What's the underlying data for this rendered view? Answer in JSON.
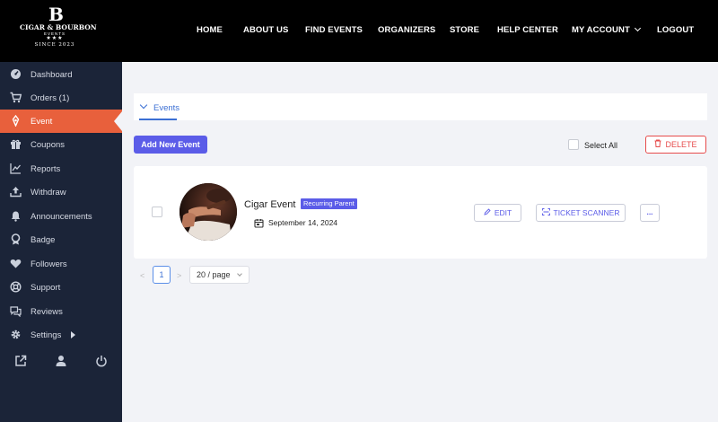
{
  "brand": {
    "mark": "B",
    "name": "CIGAR & BOURBON",
    "sub": "EVENTS",
    "stars": "★★★",
    "since": "SINCE 2023"
  },
  "nav": {
    "home": "HOME",
    "about": "ABOUT US",
    "find_events": "FIND EVENTS",
    "organizers": "ORGANIZERS",
    "store": "STORE",
    "help": "HELP CENTER",
    "account": "MY ACCOUNT",
    "logout": "LOGOUT"
  },
  "sidebar": {
    "items": [
      {
        "label": "Dashboard",
        "icon": "dashboard-icon"
      },
      {
        "label": "Orders (1)",
        "icon": "cart-icon"
      },
      {
        "label": "Event",
        "icon": "ticket-icon"
      },
      {
        "label": "Coupons",
        "icon": "gift-icon"
      },
      {
        "label": "Reports",
        "icon": "chart-icon"
      },
      {
        "label": "Withdraw",
        "icon": "upload-icon"
      },
      {
        "label": "Announcements",
        "icon": "bell-icon"
      },
      {
        "label": "Badge",
        "icon": "badge-icon"
      },
      {
        "label": "Followers",
        "icon": "heart-icon"
      },
      {
        "label": "Support",
        "icon": "lifebuoy-icon"
      },
      {
        "label": "Reviews",
        "icon": "chat-icon"
      },
      {
        "label": "Settings",
        "icon": "gear-icon"
      }
    ],
    "active_index": 2,
    "bottom_icons": [
      "external-link-icon",
      "user-icon",
      "power-icon"
    ]
  },
  "tabs": {
    "events": "Events"
  },
  "actions": {
    "add_new": "Add New Event",
    "select_all": "Select All",
    "delete": "DELETE"
  },
  "event": {
    "title": "Cigar Event",
    "badge": "Recurring Parent",
    "date": "September 14, 2024",
    "edit": "EDIT",
    "ticket_scanner": "TICKET SCANNER",
    "more": "..."
  },
  "pagination": {
    "prev": "<",
    "page": "1",
    "next": ">",
    "page_size": "20 / page"
  },
  "colors": {
    "accent": "#5b5ce8",
    "sidebar_bg": "#1b2438",
    "active_item": "#e8603c",
    "danger": "#e74c4c",
    "link": "#3b6fd4"
  }
}
